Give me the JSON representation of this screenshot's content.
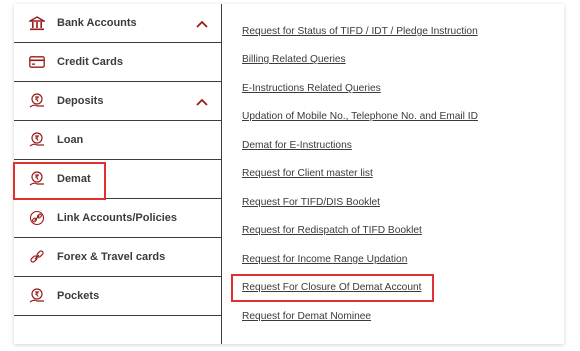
{
  "sidebar": {
    "items": [
      {
        "label": "Bank Accounts",
        "icon": "bank-icon",
        "expanded": true
      },
      {
        "label": "Credit Cards",
        "icon": "credit-card-icon"
      },
      {
        "label": "Deposits",
        "icon": "rupee-hand-icon",
        "expanded": true
      },
      {
        "label": "Loan",
        "icon": "rupee-hand-icon"
      },
      {
        "label": "Demat",
        "icon": "rupee-hand-icon",
        "selected": true
      },
      {
        "label": "Link Accounts/Policies",
        "icon": "link-icon"
      },
      {
        "label": "Forex & Travel cards",
        "icon": "travel-link-icon"
      },
      {
        "label": "Pockets",
        "icon": "rupee-hand-icon"
      }
    ]
  },
  "links": [
    "Request for Status of TIFD / IDT / Pledge Instruction",
    "Billing Related Queries",
    "E-Instructions Related Queries",
    "Updation of Mobile No., Telephone No. and Email ID",
    "Demat for E-Instructions",
    "Request for Client master list",
    "Request For TIFD/DIS Booklet",
    "Request for Redispatch of TIFD Booklet",
    "Request for Income Range Updation",
    "Request For Closure Of Demat Account",
    "Request for Demat Nominee"
  ],
  "colors": {
    "accent": "#9a1b1b",
    "highlight": "#e0302f",
    "text": "#3b3b3b"
  }
}
